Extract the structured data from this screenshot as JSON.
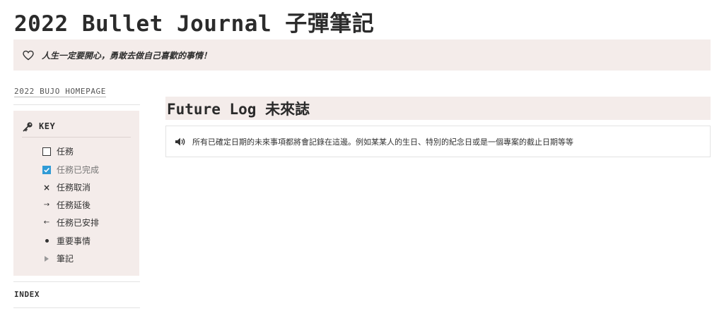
{
  "page": {
    "title": "2022 Bullet Journal 子彈筆記"
  },
  "callout": {
    "icon": "heart-outline-icon",
    "text": "人生一定要開心，勇敢去做自己喜歡的事情！"
  },
  "sidebar": {
    "home_link": "2022 BUJO HOMEPAGE",
    "key": {
      "icon": "key-icon",
      "label": "KEY",
      "items": [
        {
          "symbol": "checkbox-empty",
          "label": "任務"
        },
        {
          "symbol": "checkbox-checked",
          "label": "任務已完成"
        },
        {
          "symbol": "×",
          "label": "任務取消"
        },
        {
          "symbol": "→",
          "label": "任務延後"
        },
        {
          "symbol": "←",
          "label": "任務已安排"
        },
        {
          "symbol": "bullet-dot",
          "label": "重要事情"
        },
        {
          "symbol": "triangle-right",
          "label": "筆記"
        }
      ]
    },
    "index_label": "INDEX"
  },
  "main": {
    "section_title": "Future Log 未來誌",
    "info": {
      "icon": "speaker-icon",
      "text": "所有已確定日期的未來事項都將會記錄在這邊。例如某某人的生日、特別的紀念日或是一個專案的截止日期等等"
    }
  },
  "colors": {
    "callout_bg": "#f4ecea",
    "checkbox_checked": "#2f9bd6"
  }
}
